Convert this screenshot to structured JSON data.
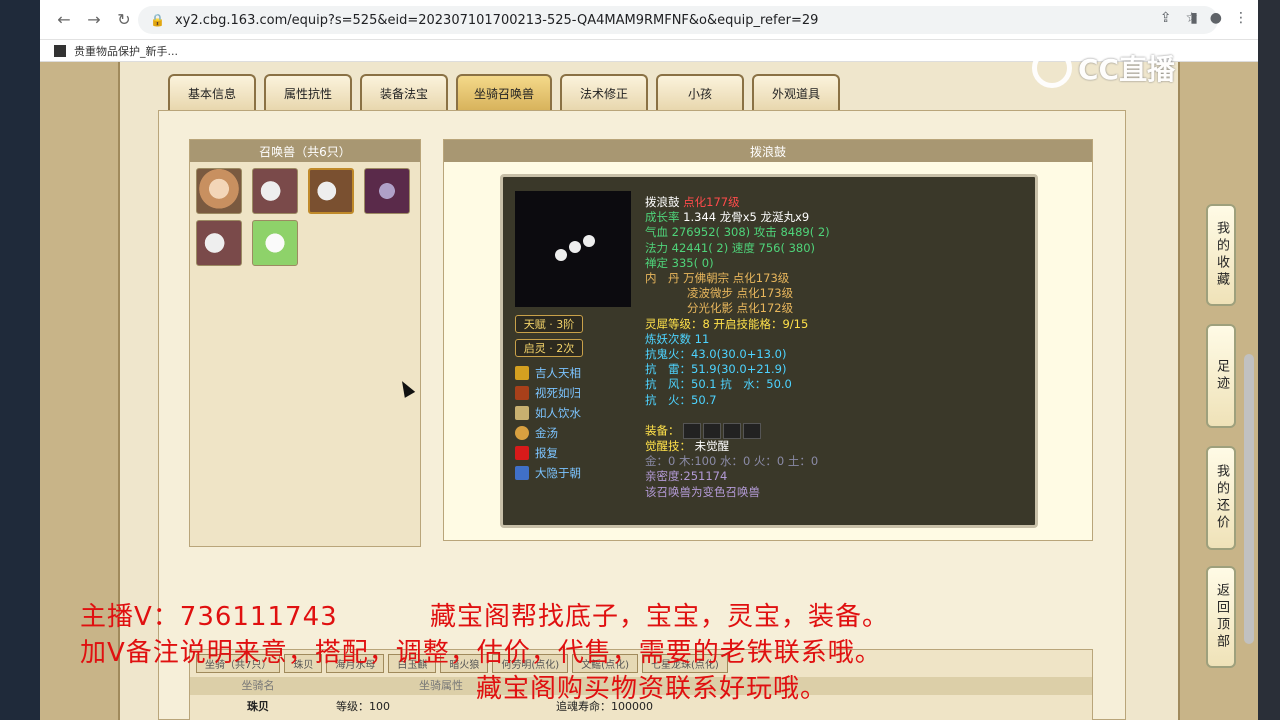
{
  "browser": {
    "url": "xy2.cbg.163.com/equip?s=525&eid=202307101700213-525-QA4MAM9RMFNF&o&equip_refer=29",
    "bookmark": "贵重物品保护_新手..."
  },
  "tabs": [
    "基本信息",
    "属性抗性",
    "装备法宝",
    "坐骑召唤兽",
    "法术修正",
    "小孩",
    "外观道具"
  ],
  "active_tab": "坐骑召唤兽",
  "summon_panel": {
    "title": "召唤兽（共6只）"
  },
  "detail_panel": {
    "title": "拨浪鼓",
    "badges": {
      "talent": "天赋 · 3阶",
      "qiling": "启灵 · 2次"
    },
    "skills": [
      "吉人天相",
      "视死如归",
      "如人饮水",
      "金汤",
      "报复",
      "大隐于朝"
    ],
    "stats": {
      "name": "拨浪鼓",
      "level": "点化177级",
      "growth_label": "成长率",
      "growth": "1.344 龙骨x5 龙涎丸x9",
      "hp_label": "气血",
      "hp": "276952( 308)",
      "atk_label": "攻击",
      "atk": "8489( 2)",
      "mp_label": "法力",
      "mp": "42441( 2)",
      "spd_label": "速度",
      "spd": "756( 380)",
      "zen_label": "禅定",
      "zen": "335( 0)",
      "neidan_label": "内　丹",
      "neidan1": "万佛朝宗 点化173级",
      "neidan2": "凌波微步 点化173级",
      "neidan3": "分光化影 点化172级",
      "lingxi_label": "灵犀等级：",
      "lingxi": "8 开启技能格：9/15",
      "lianyao": "炼妖次数 11",
      "kang_guihuo_label": "抗鬼火：",
      "kang_guihuo": "43.0(30.0+13.0)",
      "kang_lei_label": "抗　雷：",
      "kang_lei": "51.9(30.0+21.9)",
      "kang_feng_label": "抗　风：",
      "kang_feng": "50.1 抗　水：50.0",
      "kang_huo_label": "抗　火：",
      "kang_huo": "50.7",
      "equip_label": "装备：",
      "awaken_label": "觉醒技：",
      "awaken": "未觉醒",
      "elements": "金：0 木:100 水：0 火：0 土：0",
      "intimacy": "亲密度:251174",
      "variant": "该召唤兽为变色召唤兽"
    }
  },
  "lower_section": {
    "tabs": [
      "坐骑（共7只）",
      "珠贝",
      "海月水母",
      "白玉麒",
      "暗火狼",
      "何劳明(点化)",
      "文鳐(点化)",
      "七星龙珠(点化)"
    ],
    "head": [
      "坐骑名",
      "坐骑属性"
    ],
    "row": {
      "name": "珠贝",
      "level": "等级：100",
      "life": "追魂寿命：100000"
    }
  },
  "side_buttons": [
    "我的收藏",
    "足迹",
    "我的还价",
    "返回顶部"
  ],
  "overlay": {
    "logo": "CC直播",
    "line1a": "主播V：736111743",
    "line1b": "藏宝阁帮找底子，宝宝，灵宝，装备。",
    "line2": "加V备注说明来意，搭配，调整，估价，代售，需要的老铁联系哦。",
    "line3": "藏宝阁购买物资联系好玩哦。"
  }
}
